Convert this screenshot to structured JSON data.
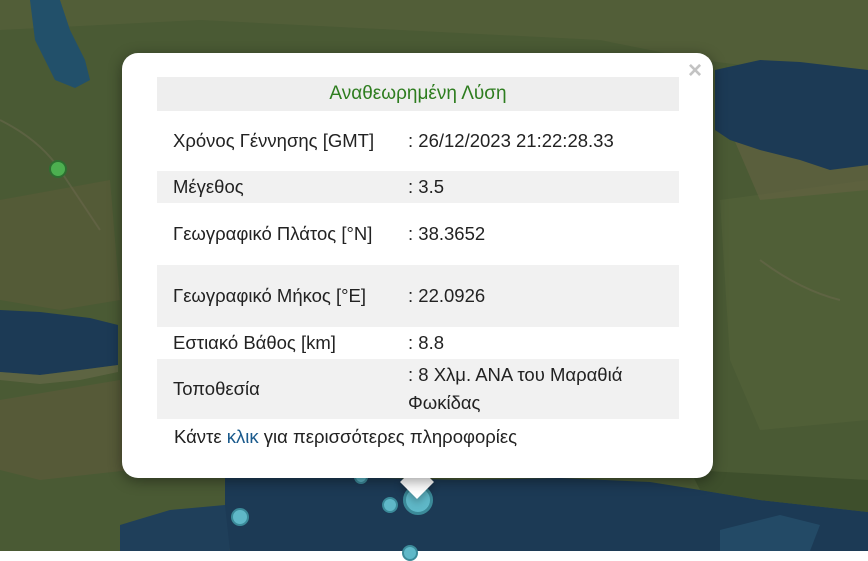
{
  "popup": {
    "header": "Αναθεωρημένη Λύση",
    "close_symbol": "×",
    "rows": [
      {
        "key": "Χρόνος Γέννησης [GMT]",
        "value": ": 26/12/2023 21:22:28.33"
      },
      {
        "key": "Μέγεθος",
        "value": ": 3.5"
      },
      {
        "key": "Γεωγραφικό Πλάτος [°N]",
        "value": ": 38.3652"
      },
      {
        "key": "Γεωγραφικό Μήκος [°E]",
        "value": ": 22.0926"
      },
      {
        "key": "Εστιακό Βάθος [km]",
        "value": ": 8.8"
      },
      {
        "key": "Τοποθεσία",
        "value": ": 8 Χλμ. ΑΝΑ του Μαραθιά Φωκίδας"
      }
    ],
    "more_pre": "Κάντε",
    "more_link": "κλικ",
    "more_post": "για περισσότερες πληροφορίες"
  },
  "colors": {
    "land": "#4a5a34",
    "water": "#1c3a55",
    "header_text": "#2e7d1f",
    "link": "#1a5a8c",
    "marker_green": "#4caf50",
    "marker_blue": "#5fb8c8"
  }
}
